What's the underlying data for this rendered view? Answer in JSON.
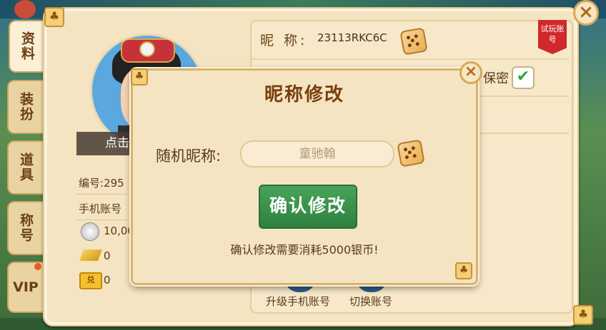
{
  "tabs": [
    {
      "label": "资料"
    },
    {
      "label": "装扮"
    },
    {
      "label": "道具"
    },
    {
      "label": "称号"
    },
    {
      "label": "VIP"
    }
  ],
  "profile": {
    "avatar_overlay": "点击",
    "id_label": "编号:",
    "id_value": "295",
    "phone_label": "手机账号",
    "silver": "10,00",
    "gold": "0",
    "tickets": "0",
    "ticket_icon_text": "兑"
  },
  "info": {
    "nickname_label": "昵 称:",
    "nickname_value": "23113RKC6C",
    "trial_badge": "试玩账号",
    "secret_label": "保密",
    "upgrade_label": "升级手机账号",
    "switch_label": "切换账号"
  },
  "dialog": {
    "title": "昵称修改",
    "random_label": "随机昵称:",
    "input_value": "童驰翰",
    "confirm_label": "确认修改",
    "cost_note": "确认修改需要消耗5000银币!"
  },
  "colors": {
    "panel": "#f4e4c2",
    "confirm_green": "#47a45a",
    "trial_red": "#d0282c",
    "text_brown": "#5a3a1c"
  },
  "icons": {
    "close": "close-icon",
    "dice": "dice-icon",
    "check": "check-icon",
    "club": "club-icon",
    "silver_coin": "silver-coin-icon",
    "gold_bar": "gold-bar-icon"
  }
}
